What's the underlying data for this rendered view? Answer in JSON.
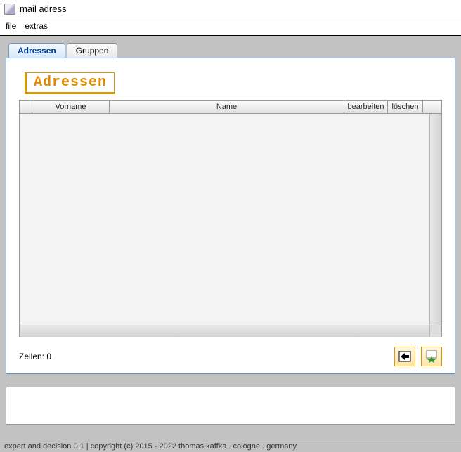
{
  "window": {
    "title": "mail adress"
  },
  "menu": {
    "file": "file",
    "extras": "extras"
  },
  "tabs": [
    "Adressen",
    "Gruppen"
  ],
  "section": {
    "title": "Adressen"
  },
  "table": {
    "headers": {
      "vorname": "Vorname",
      "name": "Name",
      "bearbeiten": "bearbeiten",
      "loeschen": "löschen"
    },
    "rows": []
  },
  "footer": {
    "row_count_label": "Zeilen: 0"
  },
  "status": {
    "text": "expert and decision 0.1 | copyright (c) 2015 - 2022 thomas kaffka . cologne . germany"
  }
}
